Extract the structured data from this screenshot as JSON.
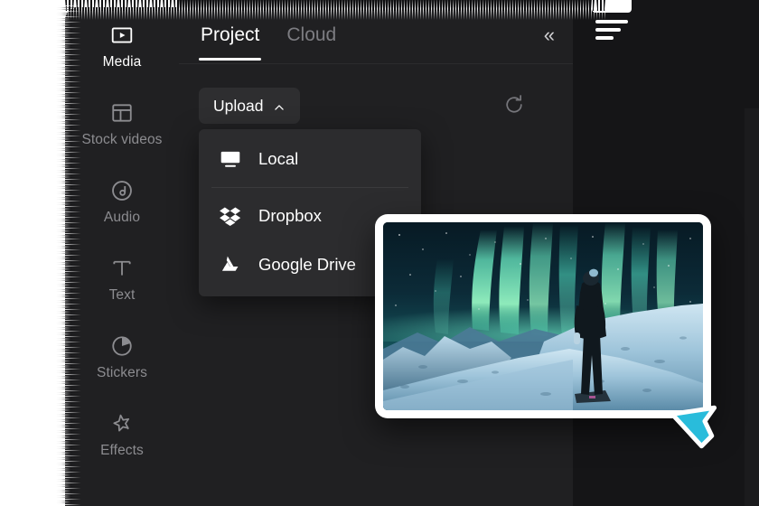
{
  "app": {
    "panel_bg": "#202022",
    "accent": "#ffffff",
    "cursor_color": "#29bcdb"
  },
  "sidebar": {
    "items": [
      {
        "label": "Media",
        "icon": "media-icon",
        "active": true
      },
      {
        "label": "Stock videos",
        "icon": "stock-videos-icon",
        "active": false
      },
      {
        "label": "Audio",
        "icon": "audio-icon",
        "active": false
      },
      {
        "label": "Text",
        "icon": "text-icon",
        "active": false
      },
      {
        "label": "Stickers",
        "icon": "stickers-icon",
        "active": false
      },
      {
        "label": "Effects",
        "icon": "effects-icon",
        "active": false
      }
    ]
  },
  "tabs": {
    "items": [
      {
        "label": "Project",
        "active": true
      },
      {
        "label": "Cloud",
        "active": false
      }
    ],
    "collapse_label": "«",
    "collapse_icon": "chevron-double-left-icon"
  },
  "toolbar": {
    "upload_label": "Upload",
    "upload_chevron_icon": "chevron-up-icon",
    "refresh_icon": "refresh-icon"
  },
  "upload_menu": {
    "items": [
      {
        "label": "Local",
        "icon": "monitor-icon"
      },
      {
        "label": "Dropbox",
        "icon": "dropbox-icon"
      },
      {
        "label": "Google Drive",
        "icon": "google-drive-icon"
      }
    ]
  },
  "thumbnail": {
    "alt": "Aurora borealis over snowy mountains with a person standing"
  }
}
